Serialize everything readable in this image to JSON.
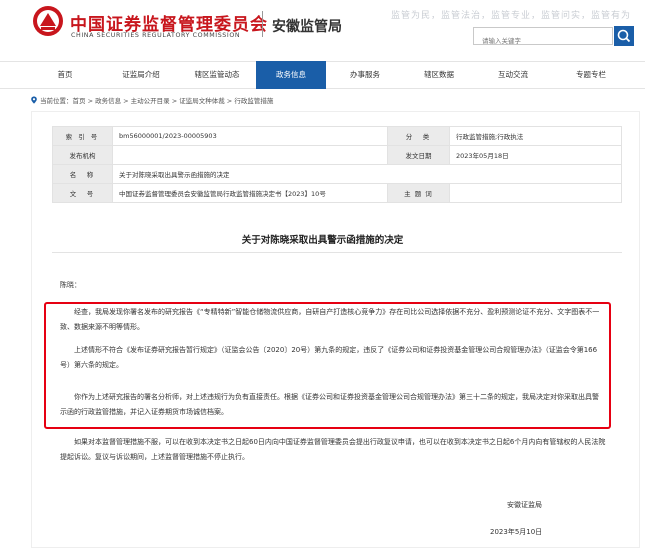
{
  "header": {
    "org_cn": "中国证券监督管理委员会",
    "org_en": "CHINA SECURITIES REGULATORY COMMISSION",
    "bureau": "安徽监管局",
    "bg_words": "监管为民，监管法治，监管专业，监管问实，监管有为",
    "search_placeholder": "请输入关键字",
    "brand_color": "#c8161d",
    "accent_color": "#1a5ea8"
  },
  "nav": {
    "items": [
      {
        "label": "首页"
      },
      {
        "label": "证监局介绍"
      },
      {
        "label": "辖区监管动态"
      },
      {
        "label": "政务信息"
      },
      {
        "label": "办事服务"
      },
      {
        "label": "辖区数据"
      },
      {
        "label": "互动交流"
      },
      {
        "label": "专题专栏"
      }
    ],
    "active_index": 3
  },
  "breadcrumb": {
    "text": "当前位置：首页 > 政务信息 > 主动公开目录 > 证监局文种体裁 > 行政监管措施"
  },
  "meta": {
    "index_label": "索 引 号",
    "index_value": "bm56000001/2023-00005903",
    "category_label": "分　类",
    "category_value": "行政监管措施;行政执法",
    "issuer_label": "发布机构",
    "issuer_value": "",
    "date_label": "发文日期",
    "date_value": "2023年05月18日",
    "name_label": "名　称",
    "name_value": "关于对陈晓采取出具警示函措施的决定",
    "docno_label": "文　号",
    "docno_value": "中国证券监督管理委员会安徽监管局行政监管措施决定书【2023】10号",
    "keyword_label": "主 题 词",
    "keyword_value": ""
  },
  "doc": {
    "title": "关于对陈晓采取出具警示函措施的决定",
    "salutation": "陈晓：",
    "para1": "经查，我局发现你署名发布的研究报告《“专精特新”智能仓储物流供应商，自研自产打造核心竞争力》存在司比公司选择依据不充分、盈利预测论证不充分、文字图表不一致、数据来源不明等情形。",
    "para2": "上述情形不符合《发布证券研究报告暂行规定》（证监会公告〔2020〕20号）第九条的规定，违反了《证券公司和证券投资基金管理公司合规管理办法》（证监会令第166号）第六条的规定。",
    "para3": "你作为上述研究报告的署名分析师，对上述违规行为负有直接责任。根据《证券公司和证券投资基金管理公司合规管理办法》第三十二条的规定，我局决定对你采取出具警示函的行政监管措施，并记入证券期货市场诚信档案。",
    "para4": "如果对本监督管理措施不服，可以在收到本决定书之日起60日内向中国证券监督管理委员会提出行政复议申请，也可以在收到本决定书之日起6个月内向有管辖权的人民法院提起诉讼。复议与诉讼期间，上述监督管理措施不停止执行。",
    "signer": "安徽证监局",
    "sign_date": "2023年5月10日",
    "highlight_color": "#e60012"
  }
}
